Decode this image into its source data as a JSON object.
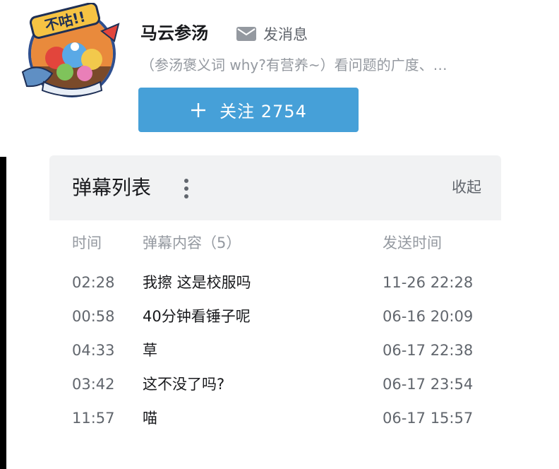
{
  "uploader": {
    "name": "马云参汤",
    "message_label": "发消息",
    "description": "（参汤褒义词 why?有营养~）看问题的广度、…",
    "follow_label": "关注 2754",
    "avatar_text": "不咕!!"
  },
  "danmaku_panel": {
    "title": "弹幕列表",
    "collapse_label": "收起",
    "columns": {
      "time": "时间",
      "content": "弹幕内容（5）",
      "sent": "发送时间"
    },
    "rows": [
      {
        "time": "02:28",
        "content": "我擦 这是校服吗",
        "sent": "11-26 22:28"
      },
      {
        "time": "00:58",
        "content": "40分钟看锤子呢",
        "sent": "06-16 20:09"
      },
      {
        "time": "04:33",
        "content": "草",
        "sent": "06-17 22:38"
      },
      {
        "time": "03:42",
        "content": "这不没了吗?",
        "sent": "06-17 23:54"
      },
      {
        "time": "11:57",
        "content": "喵",
        "sent": "06-17 15:57"
      }
    ]
  },
  "colors": {
    "follow_button": "#46a0d8",
    "panel_header_bg": "#f1f2f3",
    "text_primary": "#18191c",
    "text_secondary": "#61666d",
    "text_muted": "#9499a0"
  },
  "icons": {
    "message": "mail-icon",
    "follow": "plus-icon",
    "menu": "more-vertical-icon"
  }
}
